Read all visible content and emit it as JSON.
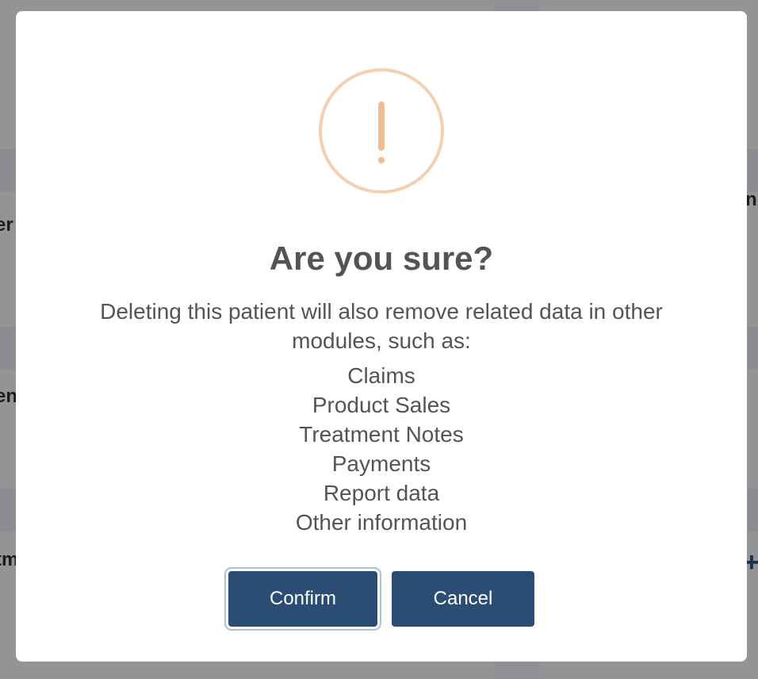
{
  "dialog": {
    "title": "Are you sure?",
    "message": "Deleting this patient will also remove related data in other modules, such as:",
    "items": [
      "Claims",
      "Product Sales",
      "Treatment Notes",
      "Payments",
      "Report data",
      "Other information"
    ],
    "icon": "warning-exclamation-icon",
    "confirm_label": "Confirm",
    "cancel_label": "Cancel"
  },
  "colors": {
    "button": "#2b4d74",
    "warning_ring": "#f5d0b0",
    "warning_mark": "#efbc8f",
    "text": "#545454"
  }
}
